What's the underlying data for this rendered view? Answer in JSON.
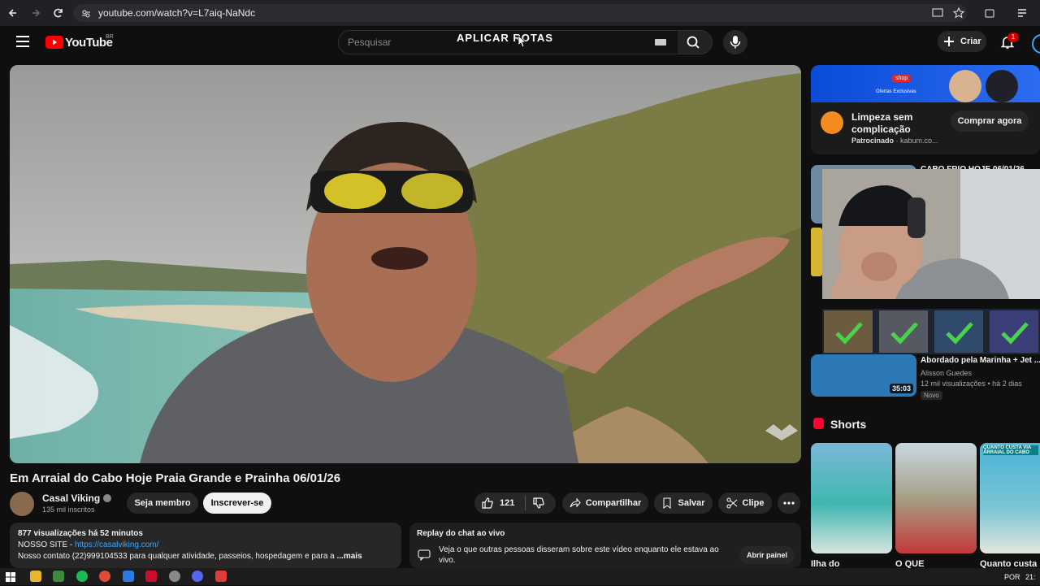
{
  "browser": {
    "url": "youtube.com/watch?v=L7aiq-NaNdc"
  },
  "youtube": {
    "logo_text": "YouTube",
    "region": "BR",
    "search_placeholder": "Pesquisar",
    "overlay_text": "APLICAR ROTAS",
    "create_label": "Criar",
    "notification_count": "1"
  },
  "video": {
    "title": "Em Arraial do Cabo Hoje Praia Grande e Prainha 06/01/26",
    "channel": "Casal Viking",
    "subscribers": "135 mil inscritos",
    "member_label": "Seja membro",
    "subscribe_label": "Inscrever-se",
    "likes": "121",
    "share_label": "Compartilhar",
    "save_label": "Salvar",
    "clip_label": "Clipe"
  },
  "description": {
    "stats": "877 visualizações  há 52 minutos",
    "site_prefix": "NOSSO SITE - ",
    "site_link": "https://casalviking.com/",
    "contact": "Nosso contato (22)999104533 para qualquer atividade, passeios, hospedagem e para a",
    "more": "...mais"
  },
  "chat": {
    "title": "Replay do chat ao vivo",
    "text": "Veja o que outras pessoas disseram sobre este vídeo enquanto ele estava ao vivo.",
    "button": "Abrir painel"
  },
  "ad": {
    "title": "Limpeza sem complicação",
    "sponsored": "Patrocinado",
    "domain": "kabum.co...",
    "cta": "Comprar agora",
    "banner_texts": [
      "shop",
      "Ofertas Exclusivas"
    ]
  },
  "recommended": [
    {
      "title": "CABO FRIO HOJE 06/01/26 ..."
    },
    {
      "title": "Abordado pela Marinha + Jet ...",
      "channel": "Alisson Guedes",
      "meta": "12 mil visualizações • há 2 dias",
      "badge": "Novo",
      "duration": "35:03"
    }
  ],
  "shorts": {
    "title": "Shorts",
    "items": [
      {
        "title": "Ilha do"
      },
      {
        "title": "O QUE"
      },
      {
        "title": "Quanto custa"
      }
    ],
    "banner_text": "QUANTO CUSTA VIA ARRAIAL DO CABO"
  },
  "taskbar": {
    "lang": "POR",
    "time": "21:"
  }
}
